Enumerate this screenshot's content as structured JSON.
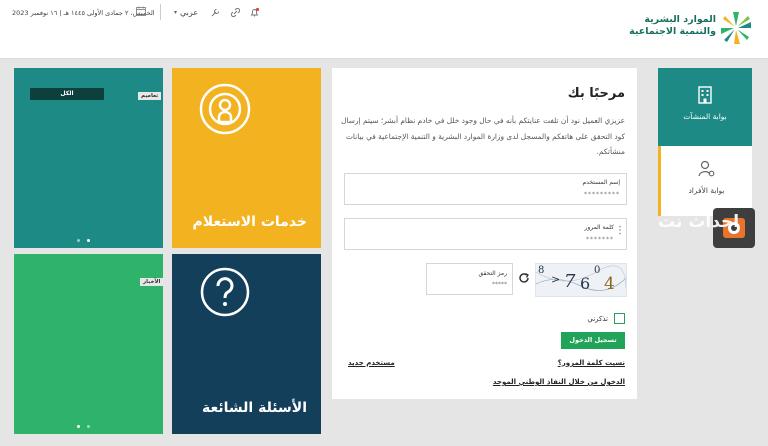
{
  "header": {
    "date_text": "الخميس، ٢ جمادى الأولى ١٤٤٥ هـ | ١٦ نوفمبر 2023",
    "language_label": "عربي",
    "logo": {
      "line1": "الموارد البشرية",
      "line2": "والتنمية الاجتماعية"
    },
    "icons": [
      "calendar-icon",
      "chevron-down-icon",
      "tools-icon",
      "link-icon",
      "bell-icon"
    ]
  },
  "tiles": {
    "teal": {
      "bar_label": "الكل",
      "tag": "تعاميم"
    },
    "yellow": {
      "title": "خدمات الاستعلام"
    },
    "green": {
      "tag": "الأخبار"
    },
    "navy": {
      "title": "الأسئلة الشائعة"
    }
  },
  "login": {
    "welcome": "مرحبًا بك",
    "intro": "عزيزي العميل نود أن تلفت عنايتكم بأنه في حال وجود خلل في خادم نظام أبشر؛ سيتم إرسال كود التحقق على هاتفكم والمسجل لدى وزارة الموارد البشرية و التنمية الإجتماعية في بيانات منشأتكم.",
    "username": {
      "label": "إسم المستخدم",
      "value": "*********"
    },
    "password": {
      "label": "كلمة المرور",
      "value": "*******"
    },
    "captcha": {
      "label": "رمز التحقق",
      "value": "*****",
      "chars": [
        "8",
        ">",
        "7",
        "6",
        "0",
        "4"
      ]
    },
    "remember_label": "تذكرني",
    "login_button": "تسجيل الدخول",
    "forgot_password": "نسيت كلمة المرور؟",
    "new_user": "مستخدم جديد",
    "nafath_link": "الدخول من خلال النفاذ الوطني الموحد"
  },
  "side_nav": [
    {
      "label": "بوابة المنشآت",
      "icon": "building-icon",
      "active": true
    },
    {
      "label": "بوابة الأفراد",
      "icon": "user-gear-icon",
      "active": false
    }
  ],
  "watermark": {
    "text": "احداث نت"
  },
  "colors": {
    "teal": "#1d8a86",
    "yellow": "#f3b21f",
    "green": "#2fb269",
    "navy": "#133f5b",
    "button": "#21a35a"
  }
}
